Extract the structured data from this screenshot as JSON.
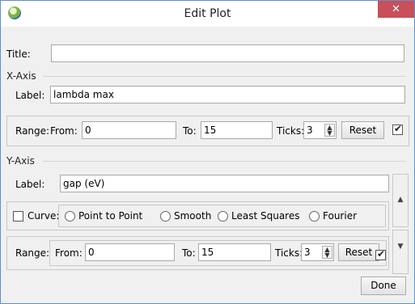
{
  "window": {
    "title": "Edit Plot",
    "close_glyph": "✕"
  },
  "title_field": {
    "label": "Title:",
    "value": ""
  },
  "x_axis": {
    "section": "X-Axis",
    "label_caption": "Label:",
    "label_value": "lambda max",
    "range_caption": "Range:",
    "from_caption": "From:",
    "from_value": "0",
    "to_caption": "To:",
    "to_value": "15",
    "ticks_caption": "Ticks:",
    "ticks_value": "3",
    "reset_label": "Reset",
    "auto_checked": true
  },
  "y_axis": {
    "section": "Y-Axis",
    "label_caption": "Label:",
    "label_value": "gap (eV)",
    "curve_caption": "Curve:",
    "curve_checked": false,
    "curve_options": [
      "Point to Point",
      "Smooth",
      "Least Squares",
      "Fourier"
    ],
    "range_caption": "Range:",
    "from_caption": "From:",
    "from_value": "0",
    "to_caption": "To:",
    "to_value": "15",
    "ticks_caption": "Ticks:",
    "ticks_value": "3",
    "reset_label": "Reset",
    "auto_checked": true
  },
  "done_label": "Done",
  "icons": {
    "app": "app-logo-icon",
    "close": "close-icon",
    "scroll_up": "scroll-up-icon",
    "scroll_down": "scroll-down-icon"
  },
  "colors": {
    "close_bg": "#c7505a",
    "window_border": "#5b8fd0"
  }
}
